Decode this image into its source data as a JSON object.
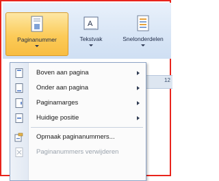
{
  "ribbon": {
    "buttons": [
      {
        "label": "Paginanummer",
        "icon": "page-number-icon",
        "active": true
      },
      {
        "label": "Tekstvak",
        "icon": "text-box-icon",
        "active": false
      },
      {
        "label": "Snelonderdelen",
        "icon": "quick-parts-icon",
        "active": false
      }
    ]
  },
  "ruler": {
    "text": "12"
  },
  "menu": {
    "items": [
      {
        "label": "Boven aan pagina",
        "icon": "page-top-icon",
        "submenu": true,
        "disabled": false
      },
      {
        "label": "Onder aan pagina",
        "icon": "page-bottom-icon",
        "submenu": true,
        "disabled": false
      },
      {
        "label": "Paginamarges",
        "icon": "page-margins-icon",
        "submenu": true,
        "disabled": false
      },
      {
        "label": "Huidige positie",
        "icon": "current-position-icon",
        "submenu": true,
        "disabled": false
      },
      {
        "label": "Opmaak paginanummers...",
        "icon": "format-page-numbers-icon",
        "submenu": false,
        "disabled": false
      },
      {
        "label": "Paginanummers verwijderen",
        "icon": "remove-page-numbers-icon",
        "submenu": false,
        "disabled": true
      }
    ]
  },
  "colors": {
    "frame_border": "#e8241c",
    "active_button": "#fccb58",
    "menu_border": "#8ca3c6"
  }
}
